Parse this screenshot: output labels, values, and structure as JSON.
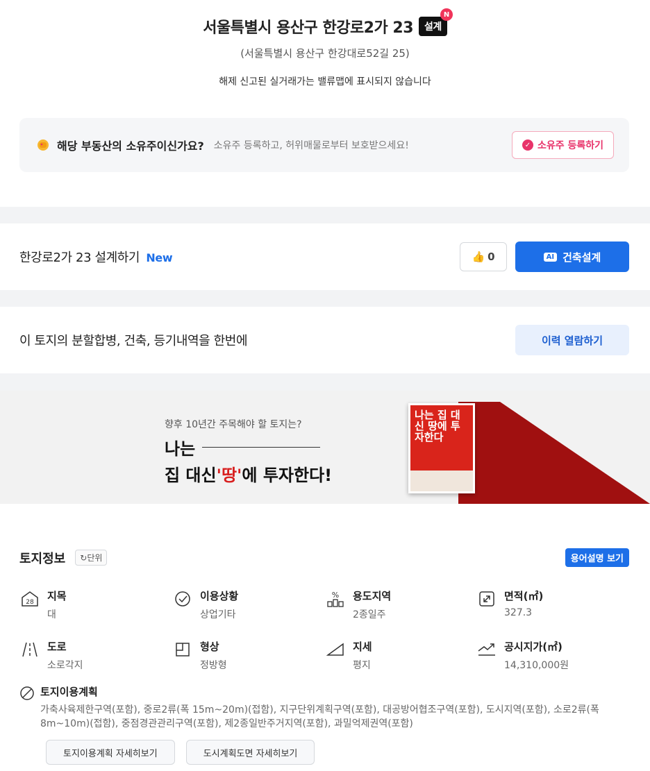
{
  "address": {
    "title": "서울특별시 용산구 한강로2가 23",
    "badge": "설계",
    "badge_new": "N",
    "road": "(서울특별시 용산구 한강대로52길 25)",
    "notice": "해제 신고된 실거래가는 밸류맵에 표시되지 않습니다"
  },
  "owner": {
    "question": "해당 부동산의 소유주이신가요?",
    "description": "소유주 등록하고, 허위매물로부터 보호받으세요!",
    "button": "소유주 등록하기",
    "icon": "hand-icon"
  },
  "design": {
    "title": "한강로2가 23 설계하기",
    "new": "New",
    "likes": "0",
    "ai_tag": "AI",
    "button": "건축설계"
  },
  "history": {
    "title": "이 토지의 분할합병, 건축, 등기내역을 한번에",
    "button": "이력 열람하기"
  },
  "banner": {
    "question": "향후 10년간 주목해야 할 토지는?",
    "line1": "나는",
    "line2_pre": "집 대신",
    "line2_red": "'땅'",
    "line2_post": "에 투자한다!",
    "book_title": "나는 집 대신 땅에 투자한다"
  },
  "land": {
    "title": "토지정보",
    "unit_button": "단위",
    "term_button": "용어설명 보기",
    "items": [
      {
        "label": "지목",
        "value": "대",
        "icon": "28-icon"
      },
      {
        "label": "이용상황",
        "value": "상업기타",
        "icon": "check-circle-icon"
      },
      {
        "label": "용도지역",
        "value": "2종일주",
        "icon": "percent-icon"
      },
      {
        "label": "면적(㎡)",
        "value": "327.3",
        "icon": "expand-icon"
      },
      {
        "label": "도로",
        "value": "소로각지",
        "icon": "road-icon"
      },
      {
        "label": "형상",
        "value": "정방형",
        "icon": "shape-icon"
      },
      {
        "label": "지세",
        "value": "평지",
        "icon": "slope-icon"
      },
      {
        "label": "공시지가(㎡)",
        "value": "14,310,000원",
        "icon": "trend-icon"
      }
    ],
    "plan": {
      "label": "토지이용계획",
      "value": "가축사육제한구역(포함), 중로2류(폭 15m~20m)(접함), 지구단위계획구역(포함), 대공방어협조구역(포함), 도시지역(포함), 소로2류(폭 8m~10m)(접함), 중점경관관리구역(포함), 제2종일반주거지역(포함), 과밀억제권역(포함)"
    },
    "buttons": [
      "토지이용계획 자세히보기",
      "도시계획도면 자세히보기"
    ]
  }
}
